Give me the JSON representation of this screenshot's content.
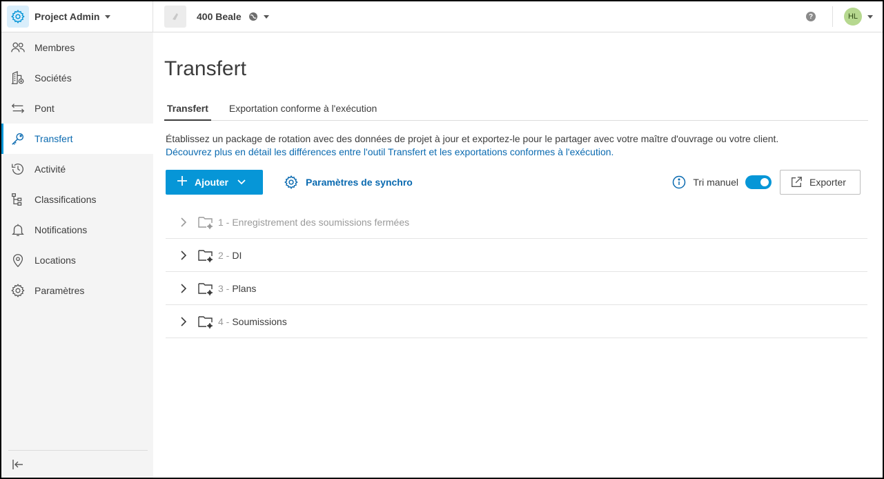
{
  "header": {
    "app_name": "Project Admin",
    "project_name": "400 Beale",
    "avatar_initials": "HL",
    "help_glyph": "?"
  },
  "sidebar": {
    "items": [
      {
        "label": "Membres",
        "icon": "members-icon"
      },
      {
        "label": "Sociétés",
        "icon": "companies-icon"
      },
      {
        "label": "Pont",
        "icon": "bridge-icon"
      },
      {
        "label": "Transfert",
        "icon": "key-icon",
        "active": true
      },
      {
        "label": "Activité",
        "icon": "history-icon"
      },
      {
        "label": "Classifications",
        "icon": "hierarchy-icon"
      },
      {
        "label": "Notifications",
        "icon": "bell-icon"
      },
      {
        "label": "Locations",
        "icon": "location-pin-icon"
      },
      {
        "label": "Paramètres",
        "icon": "gear-icon"
      }
    ]
  },
  "main": {
    "title": "Transfert",
    "tabs": [
      {
        "label": "Transfert",
        "active": true
      },
      {
        "label": "Exportation conforme à l'exécution",
        "active": false
      }
    ],
    "description": "Établissez un package de rotation avec des données de projet à jour et exportez-le pour le partager avec votre maître d'ouvrage ou votre client.",
    "learn_more": "Découvrez plus en détail les différences entre l'outil Transfert et les exportations conformes à l'exécution.",
    "toolbar": {
      "add_label": "Ajouter",
      "sync_label": "Paramètres de synchro",
      "manual_sort_label": "Tri manuel",
      "manual_sort_on": true,
      "export_label": "Exporter"
    },
    "folders": [
      {
        "num": "1 -",
        "name": "Enregistrement des soumissions fermées",
        "dim": true
      },
      {
        "num": "2 -",
        "name": "DI",
        "dim": false
      },
      {
        "num": "3 -",
        "name": "Plans",
        "dim": false
      },
      {
        "num": "4 -",
        "name": "Soumissions",
        "dim": false
      }
    ]
  },
  "colors": {
    "accent": "#0696d7",
    "link": "#0a6ab0",
    "sidebar_bg": "#f4f4f4"
  }
}
